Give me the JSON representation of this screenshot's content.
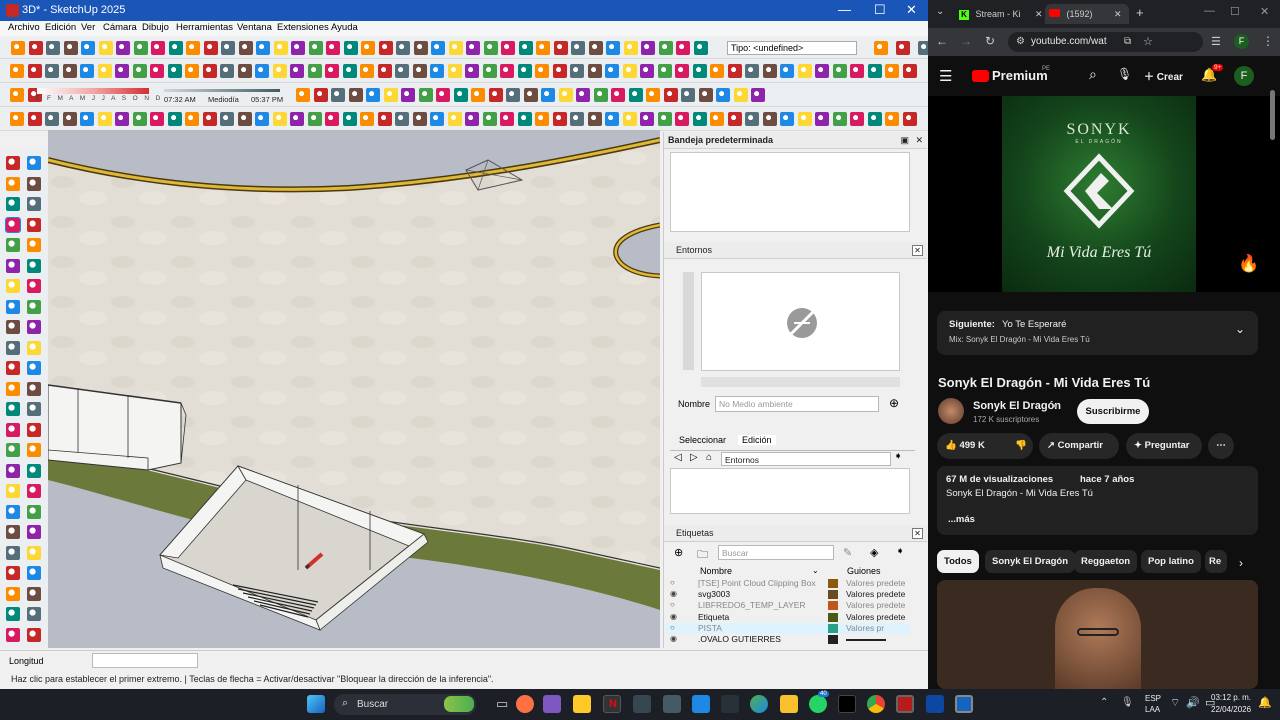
{
  "sketchup": {
    "title": "3D* - SketchUp 2025",
    "window_controls": [
      "—",
      "☐",
      "✕"
    ],
    "menu": [
      "Archivo",
      "Edición",
      "Ver",
      "Cámara",
      "Dibujo",
      "Herramientas",
      "Ventana",
      "Extensiones",
      "Ayuda"
    ],
    "type_field": "Tipo: <undefined>",
    "shadow_months": "E F M A M J J A S O N D",
    "time_start": "07:32 AM",
    "time_mid": "Mediodía",
    "time_end": "05:37 PM",
    "tray": {
      "title": "Bandeja predeterminada",
      "entornos": {
        "title": "Entornos",
        "name_label": "Nombre",
        "name_placeholder": "No Medio ambiente",
        "tab_select": "Seleccionar",
        "tab_edit": "Edición",
        "dropdown": "Entornos"
      },
      "etiquetas": {
        "title": "Etiquetas",
        "search_placeholder": "Buscar",
        "col_name": "Nombre",
        "col_dash": "Guiones",
        "rows": [
          {
            "name": "[TSE] Point Cloud Clipping Box",
            "dash": "Valores predete",
            "color": "#8a5a10",
            "visible": false
          },
          {
            "name": "svg3003",
            "dash": "Valores predete",
            "color": "#6b4a1e",
            "visible": true
          },
          {
            "name": "LIBFREDO6_TEMP_LAYER",
            "dash": "Valores predete",
            "color": "#c0561a",
            "visible": false
          },
          {
            "name": "Etiqueta",
            "dash": "Valores predete",
            "color": "#4a5a12",
            "visible": true
          },
          {
            "name": "PISTA",
            "dash": "Valores pr",
            "color": "#2aa08a",
            "visible": false
          },
          {
            "name": ".OVALO GUTIERRES",
            "dash": "",
            "color": "#222222",
            "visible": true
          }
        ]
      }
    },
    "measurement_label": "Longitud",
    "status": "Haz clic para establecer el primer extremo. | Teclas de flecha = Activar/desactivar \"Bloquear la dirección de la inferencia\"."
  },
  "browser": {
    "tabs": [
      {
        "label": "Stream - Ki"
      },
      {
        "label": "(1592)"
      }
    ],
    "url": "youtube.com/wat",
    "profile_letter": "F"
  },
  "youtube": {
    "brand": "Premium",
    "region": "PE",
    "create_label": "Crear",
    "notif_count": "9+",
    "cover_artist": "SONYK",
    "cover_sub": "EL DRAGÓN",
    "cover_title": "Mi Vida Eres Tú",
    "next_label": "Siguiente:",
    "next_title": "Yo Te Esperaré",
    "next_mix": "Mix: Sonyk El Dragón - Mi Vida Eres Tú",
    "video_title": "Sonyk El Dragón - Mi Vida Eres Tú",
    "channel": "Sonyk El Dragón",
    "subscribers": "172 K suscriptores",
    "subscribe": "Suscribirme",
    "likes": "499 K",
    "share": "Compartir",
    "ask": "Preguntar",
    "views": "67 M de visualizaciones",
    "age": "hace 7 años",
    "desc_line": "Sonyk El Dragón - Mi Vida Eres Tú",
    "more": "...más",
    "chips": [
      "Todos",
      "Sonyk El Dragón",
      "Reggaeton",
      "Pop latino",
      "Re"
    ]
  },
  "taskbar": {
    "search": "Buscar",
    "lang1": "ESP",
    "lang2": "LAA",
    "time": "03:12 p. m.",
    "date": "22/04/2026",
    "whatsapp_badge": "40"
  }
}
